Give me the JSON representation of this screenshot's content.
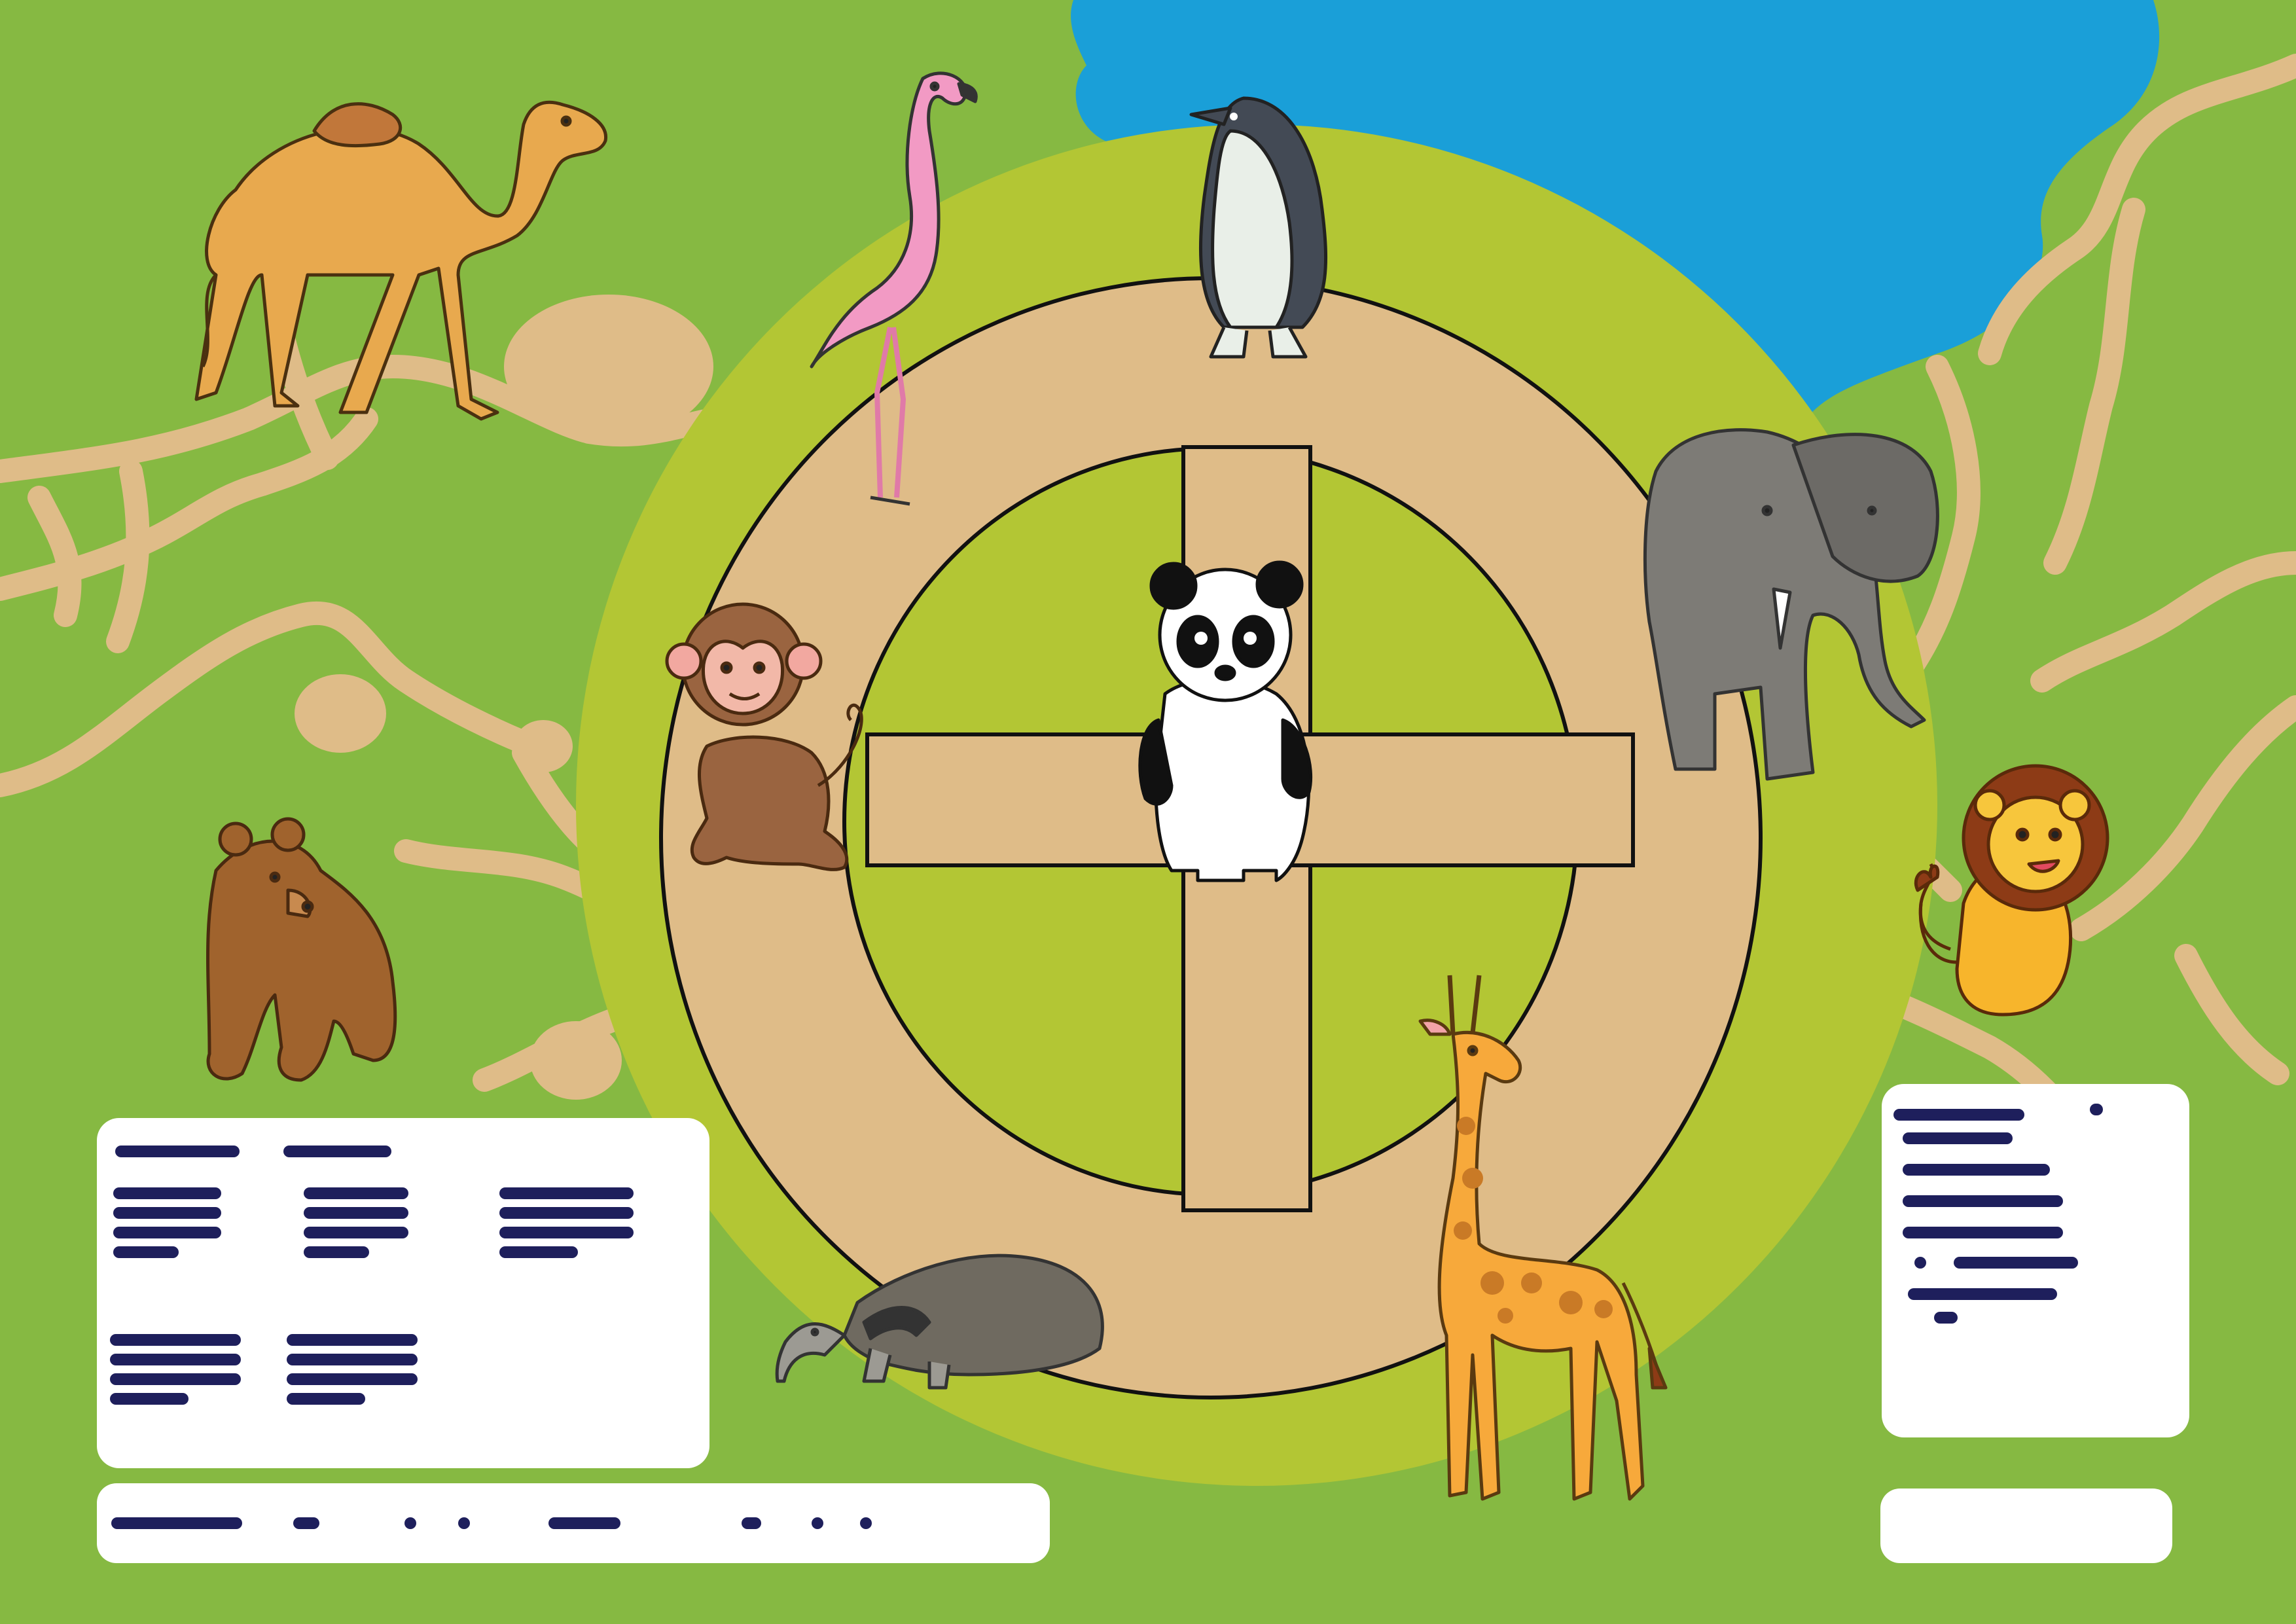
{
  "colors": {
    "grass": "#86b942",
    "meadow": "#b3c634",
    "path": "#dfbc88",
    "water": "#1a9fd8",
    "ink": "#1e1f5c",
    "card": "#ffffff",
    "outline": "#111111"
  },
  "animals": [
    {
      "id": "camel",
      "icon": "camel-icon"
    },
    {
      "id": "flamingo",
      "icon": "flamingo-icon"
    },
    {
      "id": "penguin",
      "icon": "penguin-icon"
    },
    {
      "id": "elephant",
      "icon": "elephant-icon"
    },
    {
      "id": "lion",
      "icon": "lion-icon"
    },
    {
      "id": "giraffe",
      "icon": "giraffe-icon"
    },
    {
      "id": "anteater",
      "icon": "anteater-icon"
    },
    {
      "id": "bear",
      "icon": "bear-icon"
    },
    {
      "id": "monkey",
      "icon": "monkey-icon"
    },
    {
      "id": "panda",
      "icon": "panda-icon"
    }
  ],
  "panels": {
    "legend": {
      "content": "redacted"
    },
    "info": {
      "content": "redacted"
    },
    "footer_left": {
      "content": "redacted"
    },
    "footer_right": {
      "content": "empty"
    }
  }
}
